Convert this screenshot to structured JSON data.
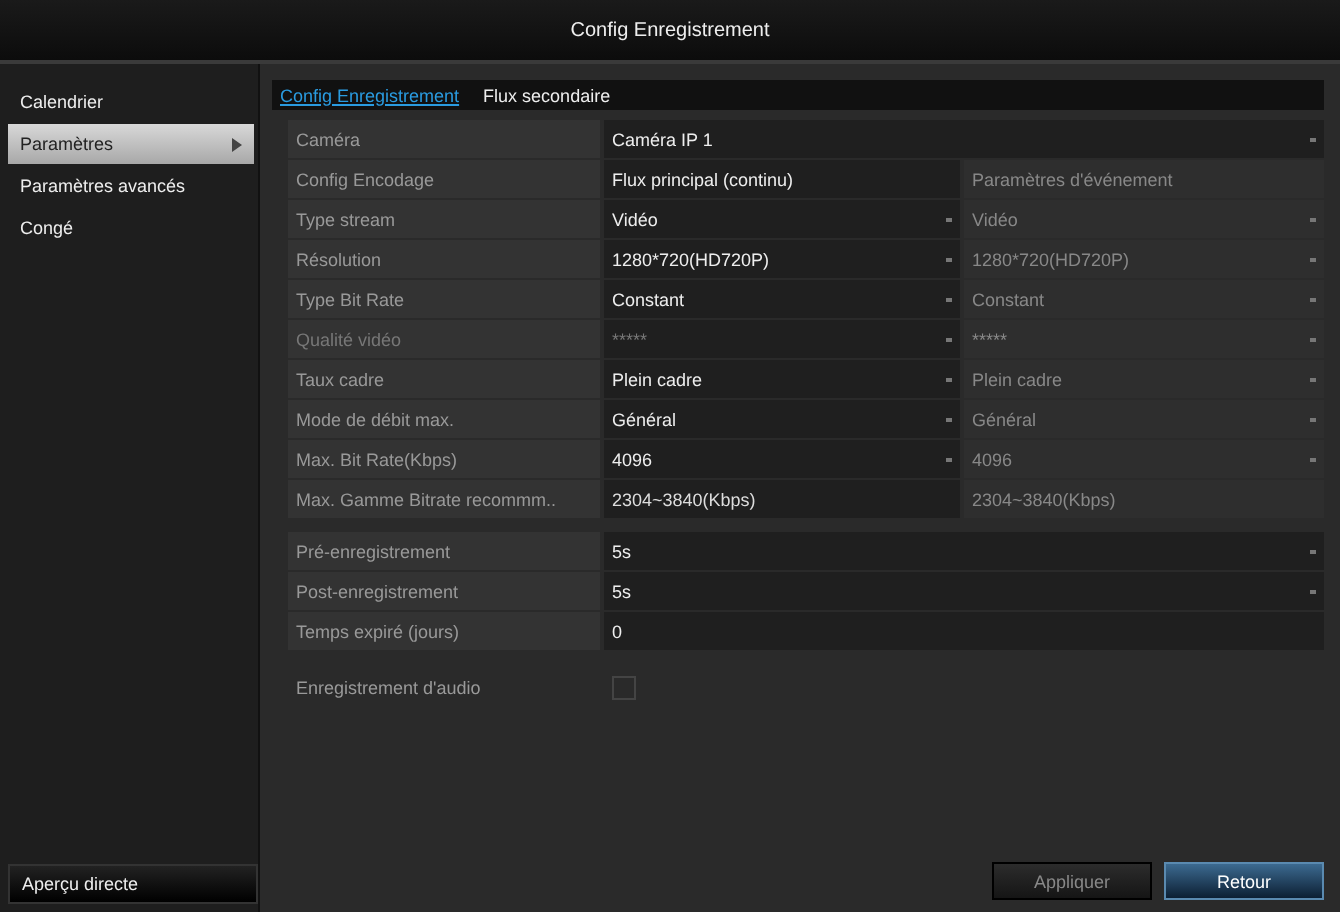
{
  "window": {
    "title": "Config Enregistrement"
  },
  "sidebar": {
    "items": [
      {
        "label": "Calendrier",
        "selected": false,
        "has_submenu": false
      },
      {
        "label": "Paramètres",
        "selected": true,
        "has_submenu": true
      },
      {
        "label": "Paramètres avancés",
        "selected": false,
        "has_submenu": false
      },
      {
        "label": "Congé",
        "selected": false,
        "has_submenu": false
      }
    ],
    "bottom_button": "Aperçu directe"
  },
  "tabs": [
    {
      "label": "Config Enregistrement",
      "selected": true
    },
    {
      "label": "Flux secondaire",
      "selected": false
    }
  ],
  "camera": {
    "label": "Caméra",
    "value": "Caméra IP 1"
  },
  "encoding": {
    "header": {
      "label": "Config Encodage",
      "main": "Flux principal (continu)",
      "event": "Paramètres d'événement"
    },
    "rows": [
      {
        "label": "Type stream",
        "main": "Vidéo",
        "event": "Vidéo",
        "kind": "select"
      },
      {
        "label": "Résolution",
        "main": "1280*720(HD720P)",
        "event": "1280*720(HD720P)",
        "kind": "select"
      },
      {
        "label": "Type Bit Rate",
        "main": "Constant",
        "event": "Constant",
        "kind": "select"
      },
      {
        "label": "Qualité vidéo",
        "main": "*****",
        "event": "*****",
        "kind": "select",
        "disabled": true
      },
      {
        "label": "Taux cadre",
        "main": "Plein cadre",
        "event": "Plein cadre",
        "kind": "select"
      },
      {
        "label": "Mode de débit max.",
        "main": "Général",
        "event": "Général",
        "kind": "select"
      },
      {
        "label": "Max. Bit Rate(Kbps)",
        "main": "4096",
        "event": "4096",
        "kind": "select"
      },
      {
        "label": "Max. Gamme Bitrate recommm..",
        "main": "2304~3840(Kbps)",
        "event": "2304~3840(Kbps)",
        "kind": "text"
      }
    ]
  },
  "record": {
    "rows": [
      {
        "label": "Pré-enregistrement",
        "value": "5s",
        "kind": "select"
      },
      {
        "label": "Post-enregistrement",
        "value": "5s",
        "kind": "select"
      },
      {
        "label": "Temps expiré (jours)",
        "value": "0",
        "kind": "text"
      }
    ],
    "audio": {
      "label": "Enregistrement d'audio",
      "checked": false
    }
  },
  "buttons": [
    {
      "label": "Appliquer",
      "disabled": true
    },
    {
      "label": "Retour",
      "disabled": false
    }
  ]
}
